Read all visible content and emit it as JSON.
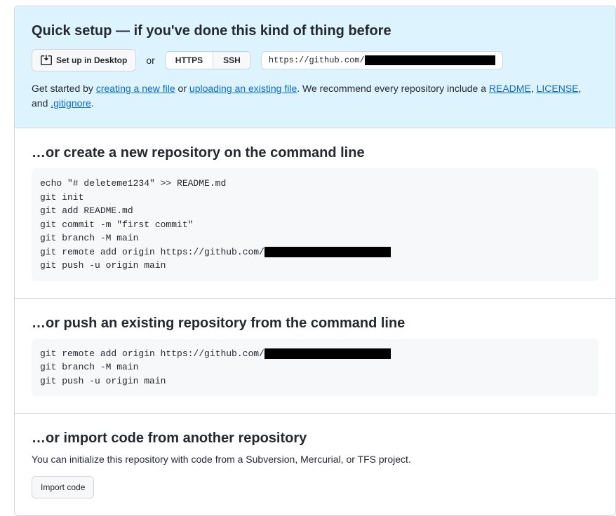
{
  "quickSetup": {
    "title": "Quick setup — if you've done this kind of thing before",
    "desktopButton": "Set up in Desktop",
    "orText": "or",
    "httpsLabel": "HTTPS",
    "sshLabel": "SSH",
    "urlPrefix": "https://github.com/",
    "helpPrefix": "Get started by ",
    "linkCreateFile": "creating a new file",
    "helpOr": " or ",
    "linkUploadFile": "uploading an existing file",
    "helpMid": ". We recommend every repository include a ",
    "linkReadme": "README",
    "helpComma": ", ",
    "linkLicense": "LICENSE",
    "helpAnd": ", and ",
    "linkGitignore": ".gitignore",
    "helpEnd": "."
  },
  "createRepo": {
    "title": "…or create a new repository on the command line",
    "lines": [
      "echo \"# deleteme1234\" >> README.md",
      "git init",
      "git add README.md",
      "git commit -m \"first commit\"",
      "git branch -M main"
    ],
    "remoteLinePrefix": "git remote add origin https://github.com/",
    "lastLine": "git push -u origin main"
  },
  "pushRepo": {
    "title": "…or push an existing repository from the command line",
    "remoteLinePrefix": "git remote add origin https://github.com/",
    "lines": [
      "git branch -M main",
      "git push -u origin main"
    ]
  },
  "importRepo": {
    "title": "…or import code from another repository",
    "desc": "You can initialize this repository with code from a Subversion, Mercurial, or TFS project.",
    "button": "Import code"
  }
}
